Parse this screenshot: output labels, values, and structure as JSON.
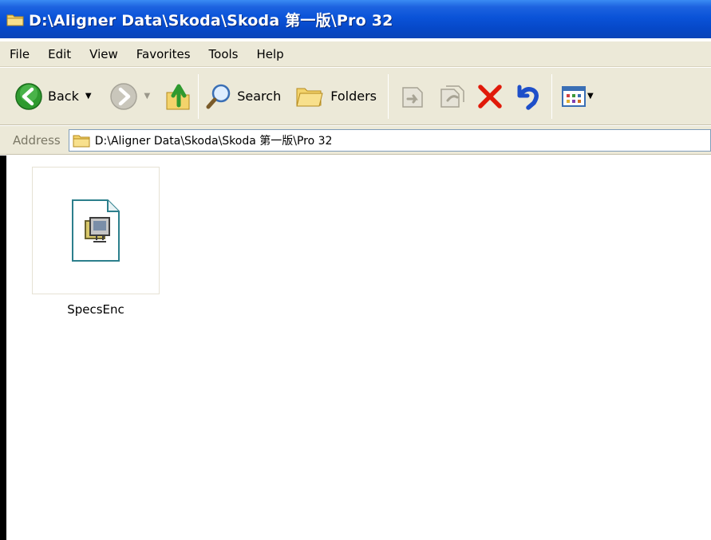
{
  "window": {
    "title": "D:\\Aligner Data\\Skoda\\Skoda 第一版\\Pro 32"
  },
  "menu": {
    "items": [
      "File",
      "Edit",
      "View",
      "Favorites",
      "Tools",
      "Help"
    ]
  },
  "toolbar": {
    "back_label": "Back",
    "search_label": "Search",
    "folders_label": "Folders"
  },
  "address": {
    "label": "Address",
    "value": "D:\\Aligner Data\\Skoda\\Skoda 第一版\\Pro 32"
  },
  "files": [
    {
      "name": "SpecsEnc",
      "icon": "document-icon"
    }
  ],
  "colors": {
    "titlebar": "#0a53d8",
    "chrome": "#ece9d8",
    "back_green": "#2f9a2f",
    "delete_red": "#e01a0a",
    "undo_blue": "#1e4fc9"
  }
}
